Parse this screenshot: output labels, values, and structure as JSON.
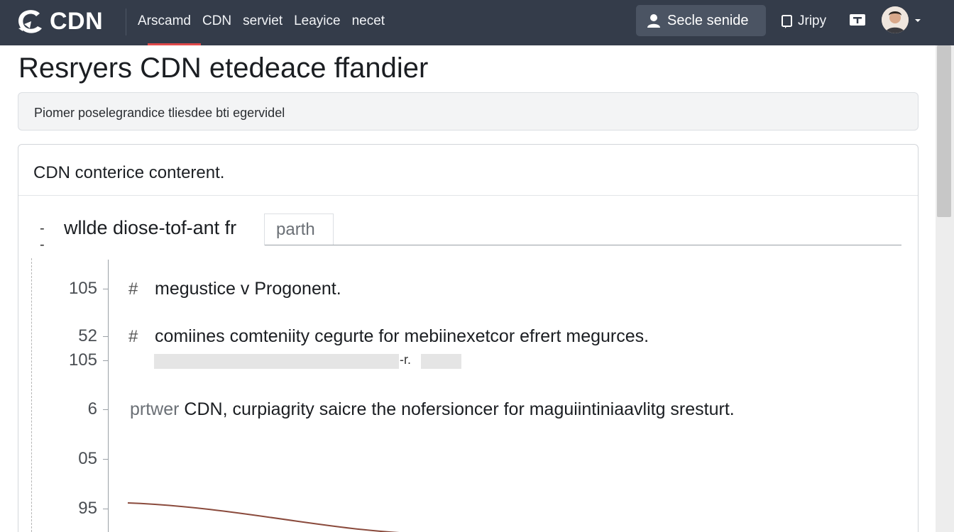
{
  "header": {
    "logo_text": "CDN",
    "nav": [
      "Arscamd",
      "CDN",
      "serviet",
      "Leayice",
      "necet"
    ],
    "select_button": "Secle senide",
    "jripy": "Jripy"
  },
  "page": {
    "title": "Resryers CDN etedeace ffandier",
    "notice": "Piomer poselegrandice tliesdee bti egervidel"
  },
  "card": {
    "header": "CDN conterice conterent.",
    "tab_dash": "--",
    "tab_label": "wllde diose-tof-ant fr",
    "tab_box": "parth"
  },
  "code": {
    "ticks": [
      "105",
      "52",
      "105",
      "6",
      "05",
      "95"
    ],
    "hash": "#",
    "line1": "megustice v Progonent.",
    "line2": "comiines comteniity cegurte for mebiinexetcor efrert megurces.",
    "bar_mid": "-r.",
    "line3_prefix": "prtwer",
    "line3": "CDN, curpiagrity saicre the nofersioncer for maguiintiniaavlitg sresturt."
  },
  "colors": {
    "topbar": "#343c4a",
    "accent_underline": "#e04a4a",
    "trend_line": "#8a4a3c"
  },
  "icons": [
    "cdn-logo-icon",
    "user-icon",
    "document-icon",
    "tv-icon",
    "chevron-down-icon"
  ]
}
